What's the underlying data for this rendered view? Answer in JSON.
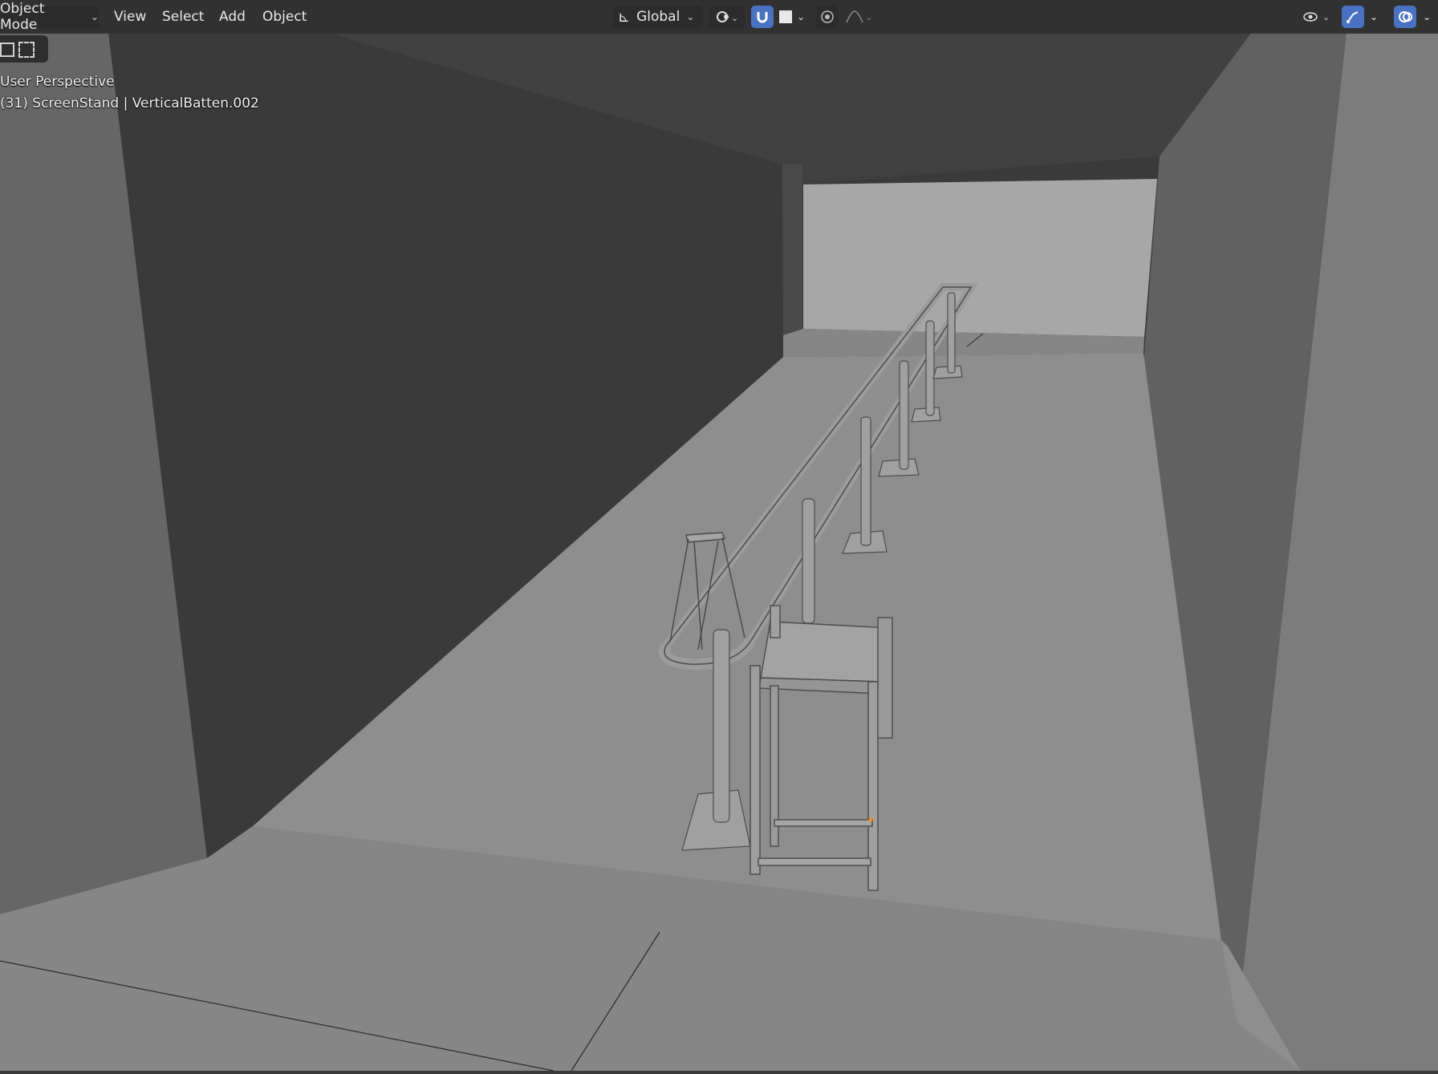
{
  "header": {
    "mode_label": "Object Mode",
    "menus": [
      "View",
      "Select",
      "Add",
      "Object"
    ],
    "orientation_label": "Global",
    "icons": [
      "transform-pivot-icon",
      "snap-icon",
      "shading-square-icon",
      "proportional-editing-icon",
      "falloff-curve-icon",
      "visibility-eye-icon",
      "gizmo-icon",
      "overlay-icon"
    ]
  },
  "viewport": {
    "perspective_label": "User Perspective",
    "object_info": "(31) ScreenStand | VerticalBatten.002"
  },
  "colors": {
    "header_bg": "#303030",
    "accent_blue": "#4a72c2",
    "wall_dark": "#3c3c3c",
    "floor": "#8a8a8a"
  }
}
